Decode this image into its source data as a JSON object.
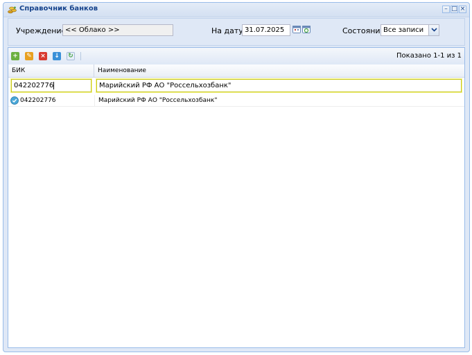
{
  "window": {
    "title": "Справочник банков",
    "title_icon": "coins-icon",
    "tools": {
      "minimize": "–",
      "maximize": "□",
      "close": "×"
    }
  },
  "filters": {
    "institution_label": "Учреждение:",
    "institution_value": "<< Облако >>",
    "date_label": "На дату:",
    "date_value": "31.07.2025",
    "state_label": "Состояние:",
    "state_value": "Все записи"
  },
  "toolbar": {
    "buttons": [
      "add-icon",
      "edit-icon",
      "delete-icon",
      "download-icon",
      "refresh-icon"
    ],
    "count_text": "Показано 1-1 из 1"
  },
  "grid": {
    "columns": [
      "БИК",
      "Наименование"
    ],
    "filter": {
      "bik": "042202776",
      "name": "Марийский РФ АО \"Россельхозбанк\""
    },
    "rows": [
      {
        "bik": "042202776",
        "name": "Марийский РФ АО \"Россельхозбанк\"",
        "status_icon": "check-circle-icon"
      }
    ]
  },
  "colors": {
    "accent": "#15428b",
    "panel": "#dfe8f6",
    "border": "#99bbe8",
    "filter_highlight": "#c8c820"
  }
}
